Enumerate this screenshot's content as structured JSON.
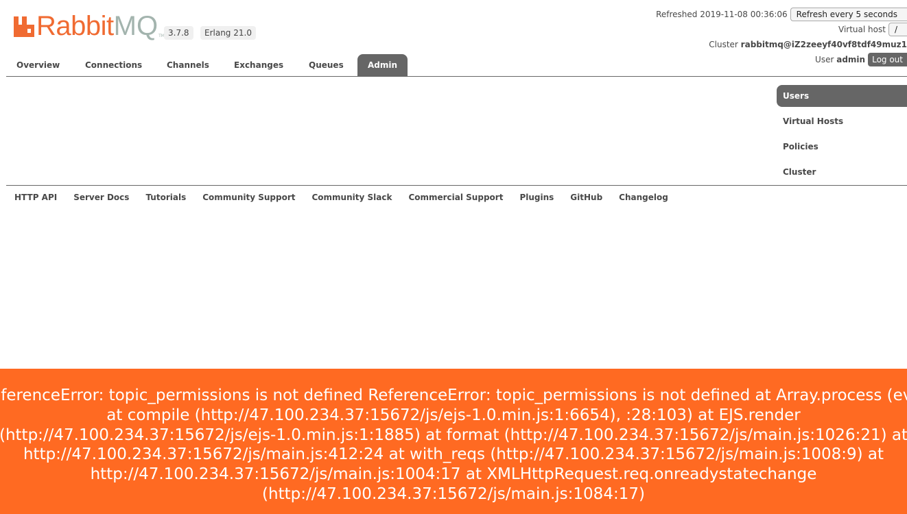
{
  "header": {
    "logo_text_rabbit": "Rabbit",
    "logo_text_mq": "MQ",
    "logo_tm": "TM",
    "version": "3.7.8",
    "erlang": "Erlang 21.0",
    "refreshed_label": "Refreshed 2019-11-08 00:36:06",
    "refresh_select": "Refresh every 5 seconds",
    "vhost_label": "Virtual host",
    "vhost_select": "/",
    "cluster_label": "Cluster",
    "cluster_name": "rabbitmq@iZ2zeeyf40vf8tdf49muz1",
    "user_label": "User",
    "user_name": "admin",
    "logout": "Log out"
  },
  "tabs": [
    "Overview",
    "Connections",
    "Channels",
    "Exchanges",
    "Queues",
    "Admin"
  ],
  "active_tab": "Admin",
  "admin_nav": [
    "Users",
    "Virtual Hosts",
    "Policies",
    "Cluster"
  ],
  "footer_links": [
    "HTTP API",
    "Server Docs",
    "Tutorials",
    "Community Support",
    "Community Slack",
    "Commercial Support",
    "Plugins",
    "GitHub",
    "Changelog"
  ],
  "error": {
    "message": "ReferenceError: topic_permissions is not defined ReferenceError: topic_permissions is not defined at Array.process (eval at compile (http://47.100.234.37:15672/js/ejs-1.0.min.js:1:6654), :28:103) at EJS.render (http://47.100.234.37:15672/js/ejs-1.0.min.js:1:1885) at format (http://47.100.234.37:15672/js/main.js:1026:21) at http://47.100.234.37:15672/js/main.js:412:24 at with_reqs (http://47.100.234.37:15672/js/main.js:1008:9) at http://47.100.234.37:15672/js/main.js:1004:17 at XMLHttpRequest.req.onreadystatechange (http://47.100.234.37:15672/js/main.js:1084:17)",
    "color": "#ff6a22"
  }
}
